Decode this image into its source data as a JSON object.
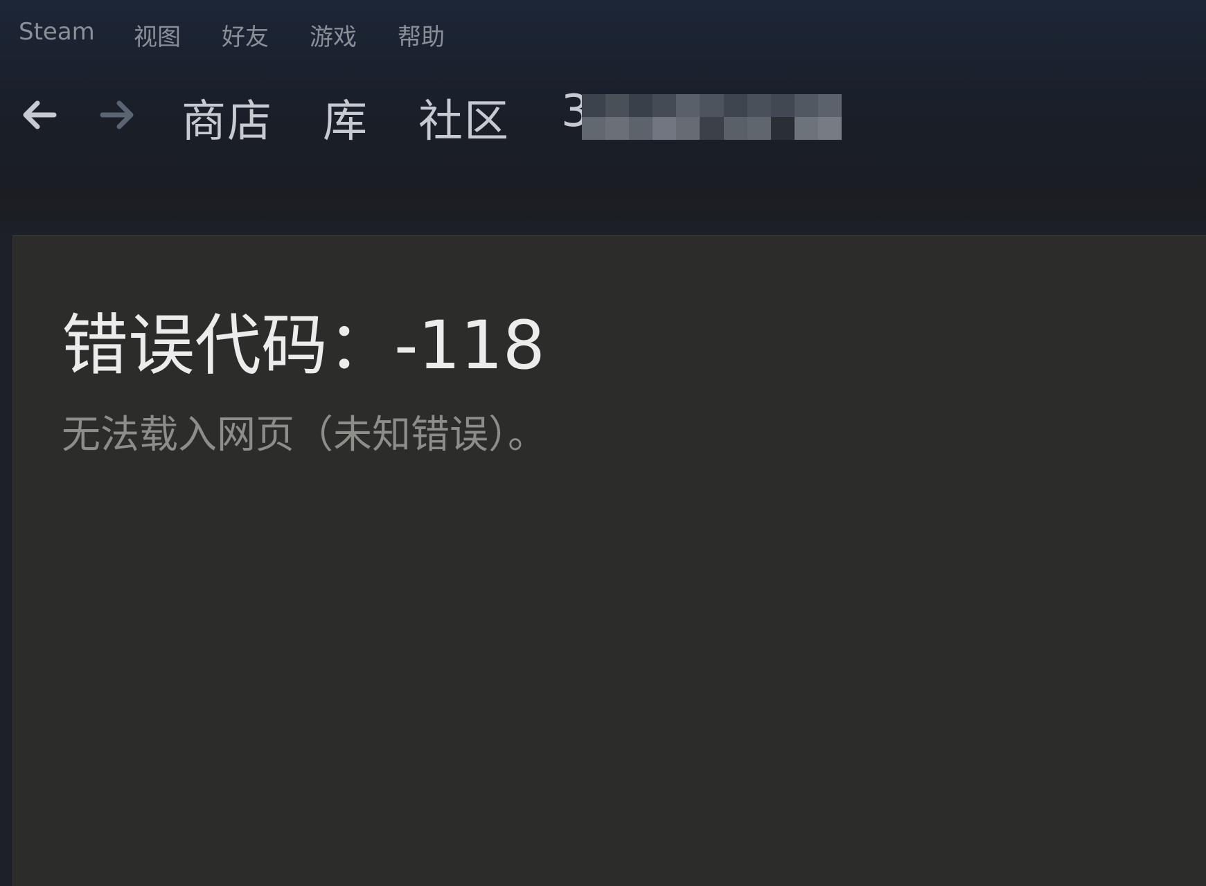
{
  "menubar": {
    "items": [
      "Steam",
      "视图",
      "好友",
      "游戏",
      "帮助"
    ]
  },
  "navbar": {
    "back_icon": "arrow-left-icon",
    "forward_icon": "arrow-right-icon",
    "links": [
      "商店",
      "库",
      "社区"
    ],
    "username": "3"
  },
  "error": {
    "title": "错误代码：-118",
    "message": "无法载入网页（未知错误）。"
  },
  "colors": {
    "menu_text": "#8a8f98",
    "nav_text": "#c7cbd1",
    "content_bg": "#2c2c2a",
    "title_text": "#ececec",
    "message_text": "#8d8d89"
  }
}
